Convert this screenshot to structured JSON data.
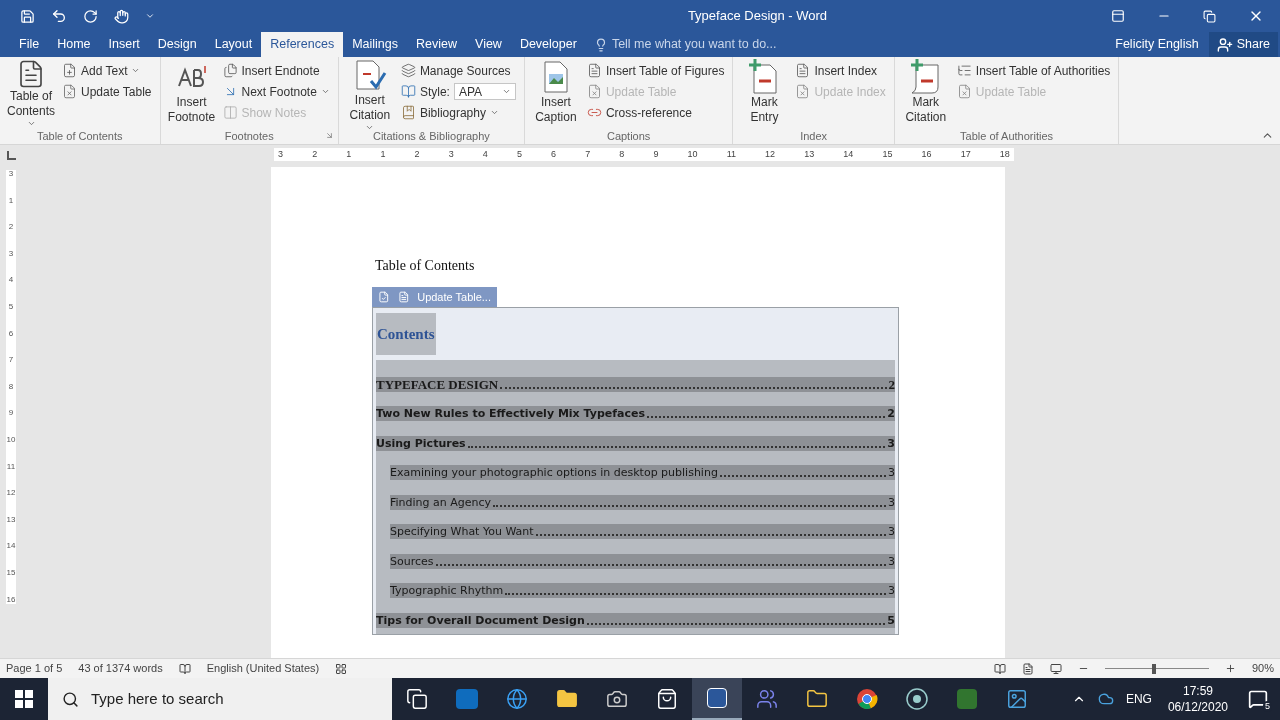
{
  "window": {
    "title": "Typeface Design - Word"
  },
  "tabs": [
    {
      "label": "File",
      "selected": false
    },
    {
      "label": "Home",
      "selected": false
    },
    {
      "label": "Insert",
      "selected": false
    },
    {
      "label": "Design",
      "selected": false
    },
    {
      "label": "Layout",
      "selected": false
    },
    {
      "label": "References",
      "selected": true
    },
    {
      "label": "Mailings",
      "selected": false
    },
    {
      "label": "Review",
      "selected": false
    },
    {
      "label": "View",
      "selected": false
    },
    {
      "label": "Developer",
      "selected": false
    }
  ],
  "tell_me": {
    "placeholder": "Tell me what you want to do..."
  },
  "user": "Felicity English",
  "share": "Share",
  "ribbon": {
    "groups": [
      {
        "label": "Table of Contents",
        "large": [
          {
            "label": "Table of Contents",
            "kind": "toc",
            "dropdown": true
          }
        ],
        "small": [
          {
            "label": "Add Text",
            "kind": "addtext",
            "dropdown": true,
            "disabled": false
          },
          {
            "label": "Update Table",
            "kind": "update",
            "dropdown": false,
            "disabled": false
          }
        ]
      },
      {
        "label": "Footnotes",
        "launcher": true,
        "large": [
          {
            "label": "Insert Footnote",
            "kind": "footnote",
            "dropdown": false
          }
        ],
        "small": [
          {
            "label": "Insert Endnote",
            "kind": "endnote",
            "dropdown": false,
            "disabled": false
          },
          {
            "label": "Next Footnote",
            "kind": "next",
            "dropdown": true,
            "disabled": false
          },
          {
            "label": "Show Notes",
            "kind": "notes",
            "dropdown": false,
            "disabled": true
          }
        ]
      },
      {
        "label": "Citations & Bibliography",
        "large": [
          {
            "label": "Insert Citation",
            "kind": "citation",
            "dropdown": true
          }
        ],
        "small": [
          {
            "label": "Manage Sources",
            "kind": "sources",
            "dropdown": false,
            "disabled": false
          },
          {
            "label": "Style:",
            "kind": "combo",
            "value": "APA"
          },
          {
            "label": "Bibliography",
            "kind": "biblio",
            "dropdown": true,
            "disabled": false
          }
        ]
      },
      {
        "label": "Captions",
        "large": [
          {
            "label": "Insert Caption",
            "kind": "caption",
            "dropdown": false
          }
        ],
        "small": [
          {
            "label": "Insert Table of Figures",
            "kind": "figures",
            "dropdown": false,
            "disabled": false
          },
          {
            "label": "Update Table",
            "kind": "update",
            "dropdown": false,
            "disabled": true
          },
          {
            "label": "Cross-reference",
            "kind": "crossref",
            "dropdown": false,
            "disabled": false
          }
        ]
      },
      {
        "label": "Index",
        "large": [
          {
            "label": "Mark Entry",
            "kind": "mark",
            "dropdown": false
          }
        ],
        "small": [
          {
            "label": "Insert Index",
            "kind": "index",
            "dropdown": false,
            "disabled": false
          },
          {
            "label": "Update Index",
            "kind": "update",
            "dropdown": false,
            "disabled": true
          }
        ]
      },
      {
        "label": "Table of Authorities",
        "large": [
          {
            "label": "Mark Citation",
            "kind": "markcite",
            "dropdown": false
          }
        ],
        "small": [
          {
            "label": "Insert Table of Authorities",
            "kind": "authorities",
            "dropdown": false,
            "disabled": false
          },
          {
            "label": "Update Table",
            "kind": "update",
            "dropdown": false,
            "disabled": true
          }
        ]
      }
    ]
  },
  "ruler": {
    "horizontal": [
      "3",
      "2",
      "1",
      "1",
      "2",
      "3",
      "4",
      "5",
      "6",
      "7",
      "8",
      "9",
      "10",
      "11",
      "12",
      "13",
      "14",
      "15",
      "16",
      "17",
      "18"
    ],
    "vertical": [
      "3",
      "1",
      "2",
      "3",
      "4",
      "5",
      "6",
      "7",
      "8",
      "9",
      "10",
      "11",
      "12",
      "13",
      "14",
      "15",
      "16"
    ]
  },
  "document": {
    "heading": "Table of Contents",
    "toc": {
      "selected": true,
      "update_label": "Update Table...",
      "title": "Contents",
      "entries": [
        {
          "title": "TYPEFACE DESIGN",
          "page": "2",
          "kind": "title"
        },
        {
          "title": "Two New Rules to Effectively Mix Typefaces",
          "page": "2",
          "kind": "heading"
        },
        {
          "title": "Using Pictures",
          "page": "3",
          "kind": "heading",
          "children": [
            {
              "title": "Examining your photographic options in desktop publishing",
              "page": "3",
              "kind": "sub"
            },
            {
              "title": "Finding an Agency",
              "page": "3",
              "kind": "sub"
            },
            {
              "title": "Specifying What You Want",
              "page": "3",
              "kind": "sub"
            },
            {
              "title": "Sources",
              "page": "3",
              "kind": "sub"
            },
            {
              "title": "Typographic Rhythm",
              "page": "3",
              "kind": "sub"
            }
          ]
        },
        {
          "title": "Tips for Overall Document Design",
          "page": "5",
          "kind": "heading"
        }
      ]
    }
  },
  "status_bar": {
    "page": "Page 1 of 5",
    "words": "43 of 1374 words",
    "language": "English (United States)",
    "zoom": "90%",
    "zoom_level": {
      "level": 0.45
    }
  },
  "taskbar": {
    "search_placeholder": "Type here to search",
    "apps": [
      {
        "kind": "taskview",
        "selected": false
      },
      {
        "kind": "outlook",
        "selected": false
      },
      {
        "kind": "edge",
        "selected": false
      },
      {
        "kind": "folder",
        "selected": false
      },
      {
        "kind": "camera",
        "selected": false
      },
      {
        "kind": "store",
        "selected": false
      },
      {
        "kind": "word",
        "selected": true
      },
      {
        "kind": "teams",
        "selected": false
      },
      {
        "kind": "files",
        "selected": false
      },
      {
        "kind": "chrome",
        "selected": false
      },
      {
        "kind": "record",
        "selected": false
      },
      {
        "kind": "project",
        "selected": false
      },
      {
        "kind": "photos",
        "selected": false
      }
    ],
    "language": "ENG",
    "time": "17:59",
    "date": "06/12/2020",
    "notifications": "5"
  }
}
